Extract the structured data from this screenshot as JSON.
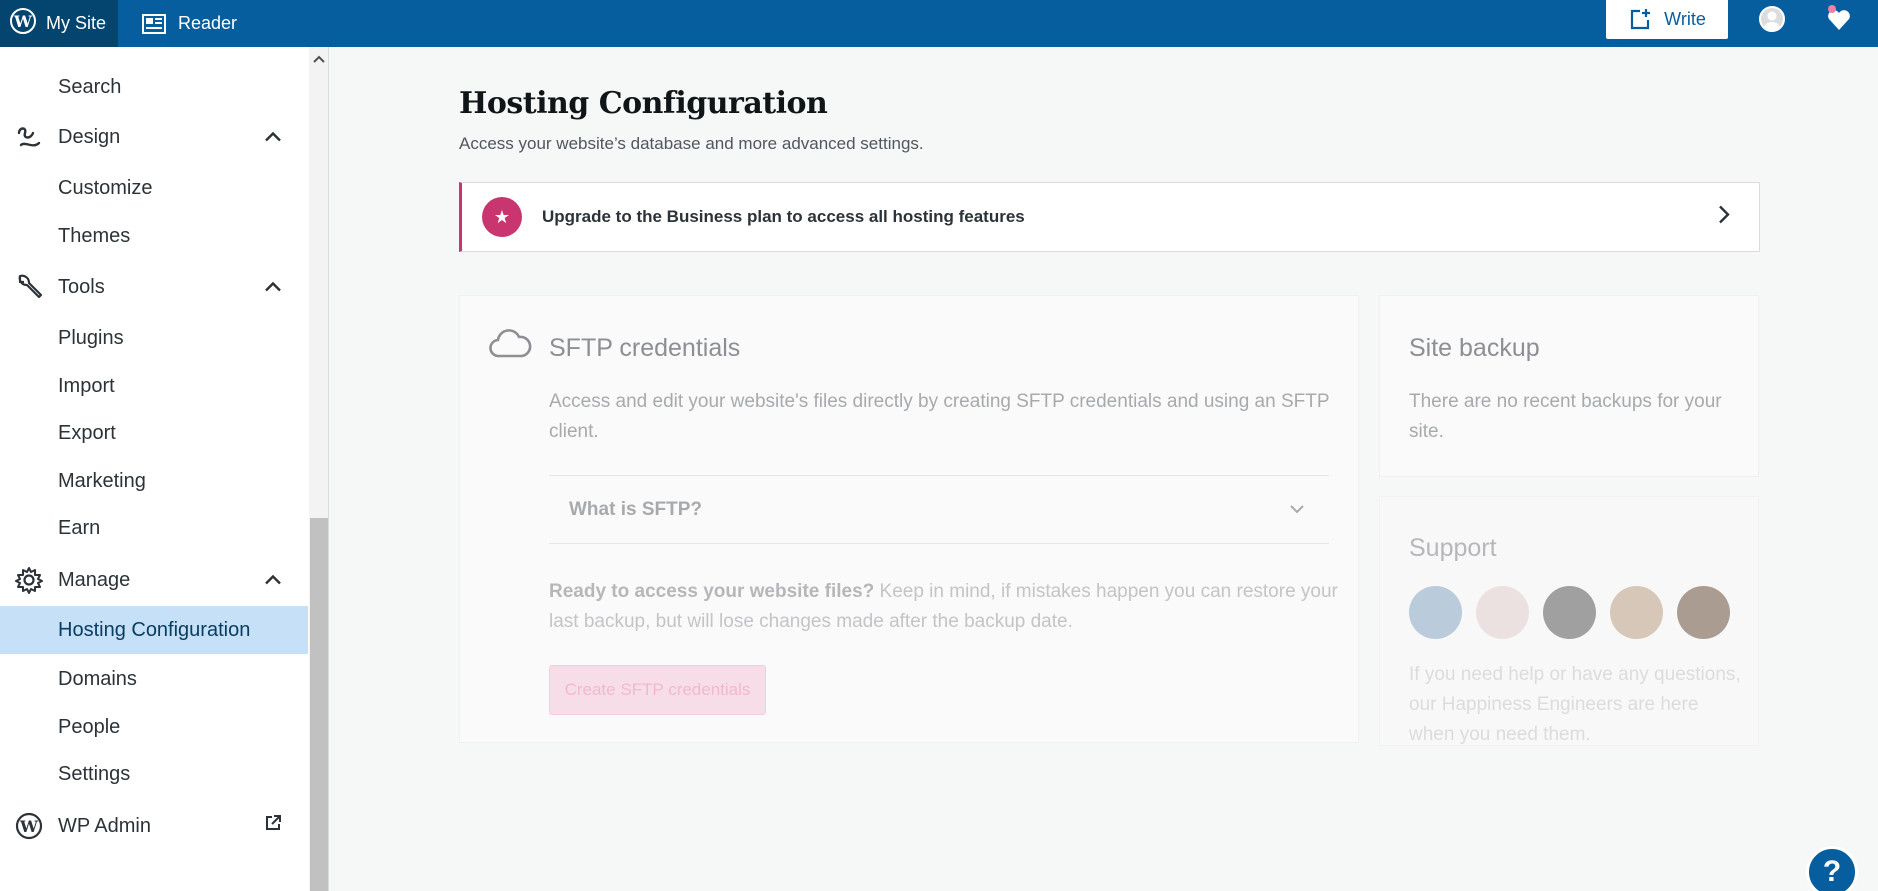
{
  "topbar": {
    "mysite_label": "My Site",
    "reader_label": "Reader",
    "write_label": "Write"
  },
  "sidebar": {
    "items": [
      {
        "label": "Search"
      },
      {
        "label": "Design"
      },
      {
        "label": "Customize"
      },
      {
        "label": "Themes"
      },
      {
        "label": "Tools"
      },
      {
        "label": "Plugins"
      },
      {
        "label": "Import"
      },
      {
        "label": "Export"
      },
      {
        "label": "Marketing"
      },
      {
        "label": "Earn"
      },
      {
        "label": "Manage"
      },
      {
        "label": "Hosting Configuration"
      },
      {
        "label": "Domains"
      },
      {
        "label": "People"
      },
      {
        "label": "Settings"
      },
      {
        "label": "WP Admin"
      }
    ]
  },
  "main": {
    "title": "Hosting Configuration",
    "subtitle": "Access your website’s database and more advanced settings.",
    "upgrade_banner": "Upgrade to the Business plan to access all hosting features",
    "sftp": {
      "title": "SFTP credentials",
      "description": "Access and edit your website's files directly by creating SFTP credentials and using an SFTP client.",
      "faq_label": "What is SFTP?",
      "ready_bold": "Ready to access your website files?",
      "ready_rest": " Keep in mind, if mistakes happen you can restore your last backup, but will lose changes made after the backup date.",
      "button_label": "Create SFTP credentials"
    },
    "backup": {
      "title": "Site backup",
      "text": "There are no recent backups for your site."
    },
    "support": {
      "title": "Support",
      "text": "If you need help or have any questions, our Happiness Engineers are here when you need them."
    },
    "help_label": "?"
  },
  "colors": {
    "topbar": "#065e9e",
    "mysite_bg": "#03456e",
    "accent_pink": "#c9356e",
    "active_item": "#c5e0f7"
  }
}
